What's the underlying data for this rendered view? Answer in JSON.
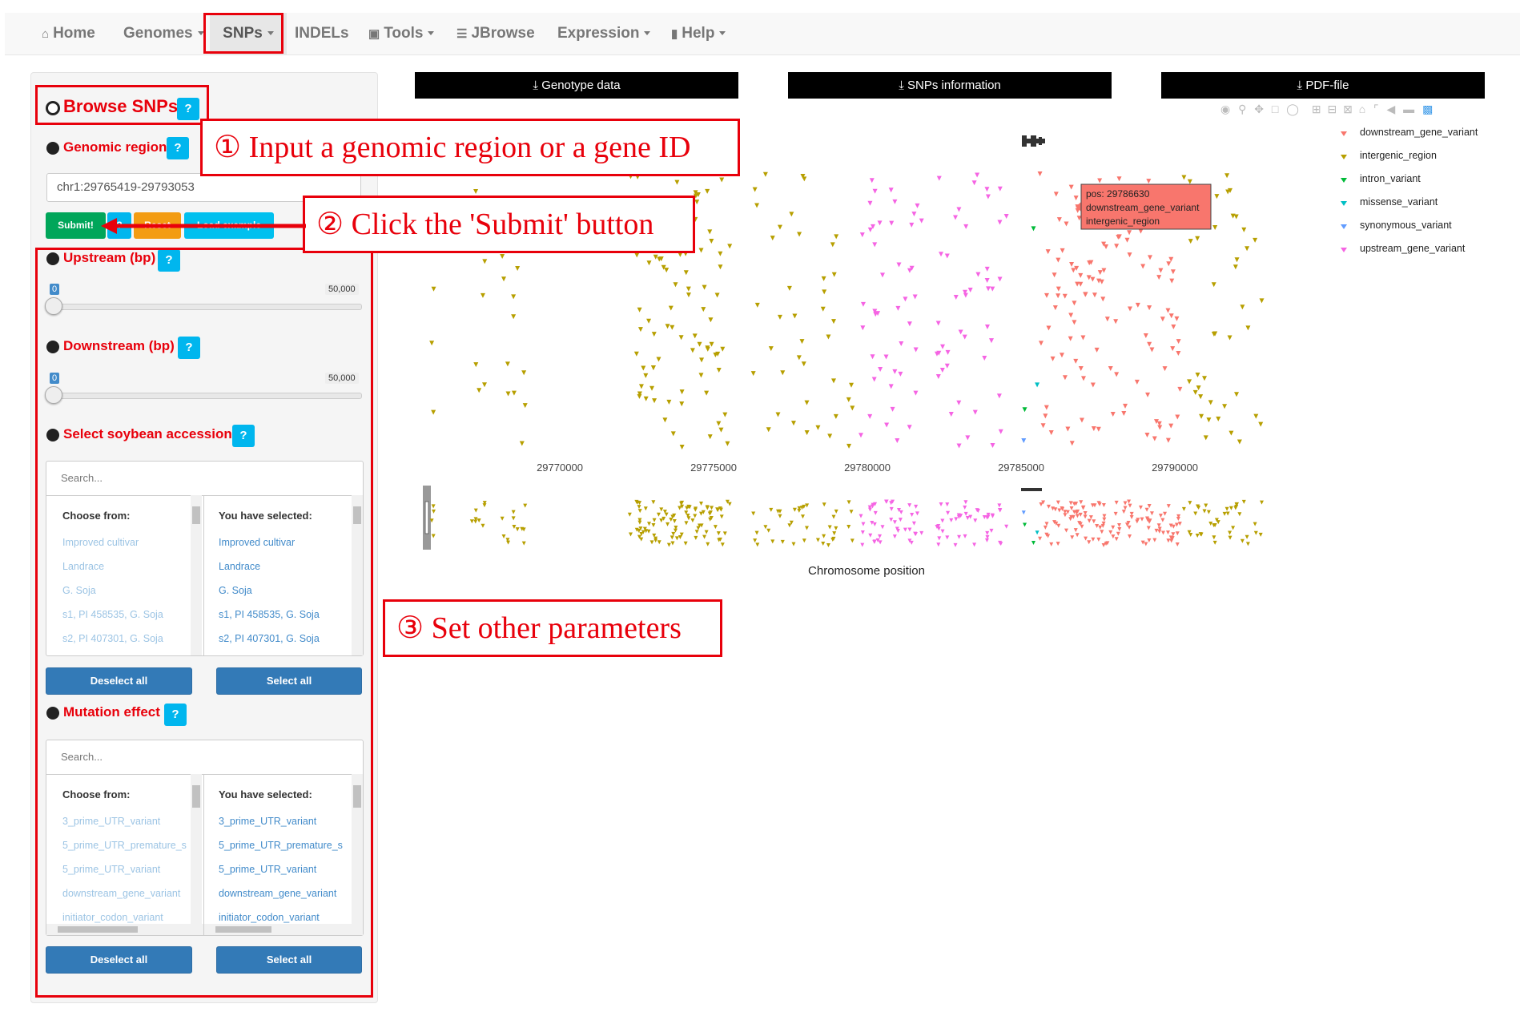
{
  "navbar": {
    "items": [
      {
        "label": "Home",
        "icon": "home-icon"
      },
      {
        "label": "Genomes",
        "icon": "",
        "dropdown": true
      },
      {
        "label": "SNPs",
        "icon": "",
        "dropdown": true,
        "active": true
      },
      {
        "label": "INDELs",
        "icon": ""
      },
      {
        "label": "Tools",
        "icon": "briefcase-icon",
        "dropdown": true
      },
      {
        "label": "JBrowse",
        "icon": "list-icon"
      },
      {
        "label": "Expression",
        "icon": "",
        "dropdown": true
      },
      {
        "label": "Help",
        "icon": "book-icon",
        "dropdown": true
      }
    ]
  },
  "sidebar": {
    "title": "Browse SNPs",
    "help": "?",
    "genomic_region": {
      "label": "Genomic region",
      "value": "chr1:29765419-29793053"
    },
    "buttons": {
      "submit": "Submit!",
      "help": "?",
      "reset": "Reset",
      "load_example": "Load example"
    },
    "upstream": {
      "label": "Upstream (bp)",
      "min": "0",
      "max": "50,000",
      "value": 0
    },
    "downstream": {
      "label": "Downstream (bp)",
      "min": "0",
      "max": "50,000",
      "value": 0
    },
    "accessions": {
      "label": "Select soybean accessions",
      "search_placeholder": "Search...",
      "choose_header": "Choose from:",
      "selected_header": "You have selected:",
      "choose_items": [
        "Improved cultivar",
        "Landrace",
        "G. Soja",
        "s1, PI 458535, G. Soja",
        "s2, PI 407301, G. Soja"
      ],
      "selected_items": [
        "Improved cultivar",
        "Landrace",
        "G. Soja",
        "s1, PI 458535, G. Soja",
        "s2, PI 407301, G. Soja"
      ],
      "deselect_all": "Deselect all",
      "select_all": "Select all"
    },
    "mutation": {
      "label": "Mutation effect",
      "search_placeholder": "Search...",
      "choose_header": "Choose from:",
      "selected_header": "You have selected:",
      "choose_items": [
        "3_prime_UTR_variant",
        "5_prime_UTR_premature_s",
        "5_prime_UTR_variant",
        "downstream_gene_variant",
        "initiator_codon_variant"
      ],
      "selected_items": [
        "3_prime_UTR_variant",
        "5_prime_UTR_premature_s",
        "5_prime_UTR_variant",
        "downstream_gene_variant",
        "initiator_codon_variant"
      ],
      "deselect_all": "Deselect all",
      "select_all": "Select all"
    }
  },
  "annotations": {
    "step1": "① Input a genomic region or a gene ID",
    "step2": "② Click the 'Submit' button",
    "step3": "③ Set other parameters"
  },
  "downloads": {
    "genotype": "Genotype data",
    "snps_info": "SNPs information",
    "pdf": "PDF-file"
  },
  "colors": {
    "downstream_gene_variant": "#f8766d",
    "intergenic_region": "#b79f00",
    "intron_variant": "#00ba38",
    "missense_variant": "#00bfc4",
    "synonymous_variant": "#619cff",
    "upstream_gene_variant": "#f564e3",
    "annotation_red": "#e8000b"
  },
  "tooltip": {
    "lines": [
      "pos: 29786630",
      "downstream_gene_variant",
      "intergenic_region"
    ]
  },
  "chart_data": {
    "type": "scatter",
    "xlabel": "Chromosome position",
    "ylabel": "",
    "xlim": [
      29765419,
      29793053
    ],
    "x_ticks": [
      "29770000",
      "29775000",
      "29780000",
      "29785000",
      "29790000"
    ],
    "grid": false,
    "legend_position": "top-right",
    "series": [
      {
        "name": "downstream_gene_variant",
        "color": "#f8766d",
        "x": [
          29785900,
          29786100,
          29786300,
          29786630,
          29786800,
          29787100,
          29787400,
          29787700,
          29788000,
          29788300,
          29788600,
          29788900,
          29789200,
          29789500,
          29789800,
          29790100,
          29786200,
          29786500,
          29787000,
          29787600,
          29788200,
          29789000,
          29789600,
          29790000,
          29787300,
          29786700,
          29788500,
          29789300,
          29785700,
          29786900,
          29787800,
          29789900
        ]
      },
      {
        "name": "intergenic_region",
        "color": "#b79f00",
        "x": [
          29765900,
          29767200,
          29767500,
          29768200,
          29768600,
          29768900,
          29772400,
          29772700,
          29773000,
          29773300,
          29773600,
          29773900,
          29774200,
          29774500,
          29774800,
          29775100,
          29775400,
          29772500,
          29772900,
          29773400,
          29773800,
          29774300,
          29774700,
          29775200,
          29772600,
          29773100,
          29773700,
          29774100,
          29774600,
          29775000,
          29776300,
          29777200,
          29777600,
          29778000,
          29778500,
          29779000,
          29779400,
          29776800,
          29777900,
          29778800,
          29790400,
          29790900,
          29791400,
          29791900,
          29792300,
          29792700,
          29790700,
          29791200,
          29791700,
          29792100
        ]
      },
      {
        "name": "intron_variant",
        "color": "#00ba38",
        "x": [
          29785200,
          29785400
        ]
      },
      {
        "name": "missense_variant",
        "color": "#00bfc4",
        "x": [
          29785500
        ]
      },
      {
        "name": "synonymous_variant",
        "color": "#619cff",
        "x": [
          29785000
        ]
      },
      {
        "name": "upstream_gene_variant",
        "color": "#f564e3",
        "x": [
          29779800,
          29780200,
          29780500,
          29780900,
          29781300,
          29781700,
          29782200,
          29782700,
          29783100,
          29783600,
          29784000,
          29784400,
          29780100,
          29780700,
          29781500,
          29782400,
          29783300,
          29784200,
          29780300,
          29781100,
          29782900,
          29783900
        ]
      }
    ]
  }
}
